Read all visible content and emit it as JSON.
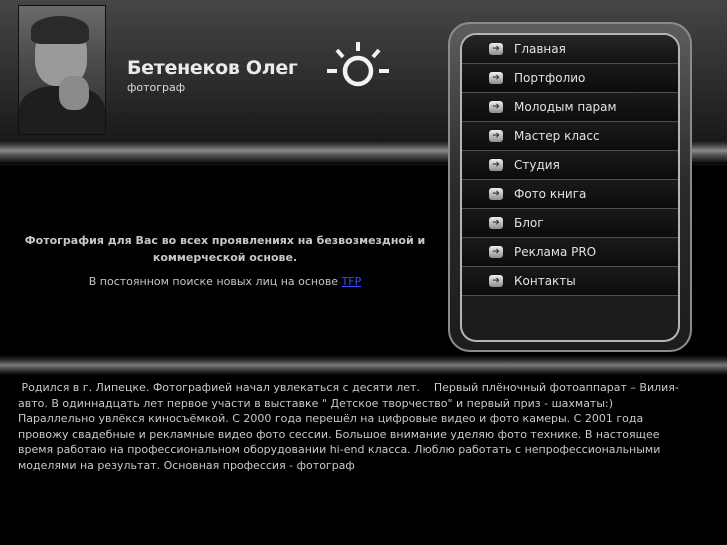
{
  "header": {
    "name": "Бетенеков Олег",
    "profession": "фотограф"
  },
  "menu": {
    "items": [
      {
        "label": "Главная"
      },
      {
        "label": "Портфолио"
      },
      {
        "label": "Молодым парам"
      },
      {
        "label": "Мастер класс"
      },
      {
        "label": "Студия"
      },
      {
        "label": "Фото книга"
      },
      {
        "label": "Блог"
      },
      {
        "label": "Реклама PRO"
      },
      {
        "label": "Контакты"
      }
    ],
    "arrow_icon": "arrow-right-icon"
  },
  "intro": {
    "headline": "Фотография для Вас во всех проявлениях на безвозмездной и коммерческой основе.",
    "search_text": "В постоянном поиске новых лиц на основе ",
    "link_text": "TFP"
  },
  "bio": {
    "text": " Родился в г. Липецке. Фотографией начал увлекаться с десяти лет.    Первый плёночный фотоаппарат – Вилия-авто. В одиннадцать лет первое участи в выставке \" Детское творчество\" и первый приз - шахматы:) Параллельно увлёкся киносъёмкой. С 2000 года перешёл на цифровые видео и фото камеры. С 2001 года провожу свадебные и рекламные видео фото сессии. Большое внимание уделяю фото технике. В настоящее время работаю на профессиональном оборудовании hi-end класса. Люблю работать с непрофессиональными моделями на результат. Основная профессия - фотограф"
  },
  "colors": {
    "background": "#000000",
    "link": "#3a4bff"
  }
}
